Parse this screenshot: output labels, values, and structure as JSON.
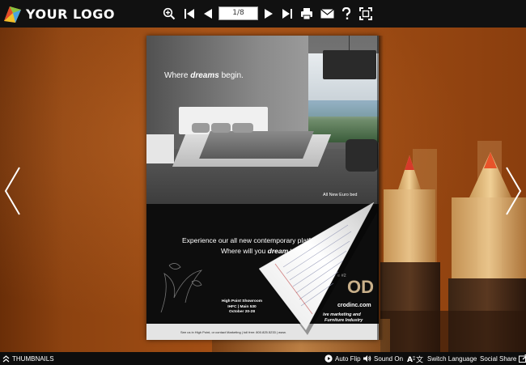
{
  "logo": {
    "text": "YOUR LOGO"
  },
  "toolbar": {
    "page_indicator": "1/8",
    "icons": [
      "zoom-in-icon",
      "first-page-icon",
      "previous-page-icon",
      "next-page-icon",
      "last-page-icon",
      "print-icon",
      "email-icon",
      "help-icon",
      "fullscreen-icon"
    ]
  },
  "page": {
    "tagline_prefix": "Where ",
    "tagline_emphasis": "dreams",
    "tagline_suffix": " begin.",
    "photo_caption": "All New Euro bed",
    "ad_line1": "Experience our all new contemporary platform bed",
    "ad_line2_prefix": "Where will you ",
    "ad_line2_emphasis": "dream",
    "ad_line2_suffix": " tonight?",
    "showroom_line1": "High Point Showroom",
    "showroom_line2": "IHFC  |  Main 530",
    "showroom_line3": "October 20-28",
    "footer": "See us in High Point, or contact Marketing  |  toll free: 800.825.5233  |  www.",
    "right_partial_od": "OD",
    "right_partial_url": "crodinc.com",
    "right_partial_1": "ive marketing and",
    "right_partial_2": "Furniture Industry",
    "right_partial_3": "e #2"
  },
  "bottombar": {
    "thumbnails": "THUMBNAILS",
    "auto_flip": "Auto Flip",
    "sound_on": "Sound On",
    "switch_language": "Switch Language",
    "social_share": "Social Share"
  },
  "colors": {
    "background": "#a04d14",
    "bar": "#111111",
    "accent_white": "#ffffff"
  }
}
